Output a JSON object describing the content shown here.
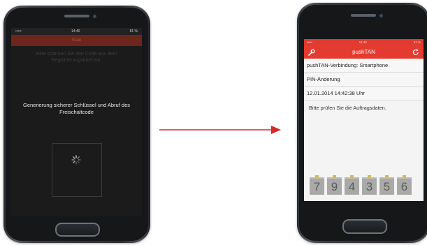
{
  "left_screen": {
    "status_time": "14:40",
    "status_carrier": "•••••",
    "status_battery": "81 %",
    "header_title": "Scan",
    "instruction": "Bitte scannen Sie den Code aus dem Registrierungsbrief ein.",
    "overlay": "Generierung sicherer Schlüssel und Abruf des Freischaltcode"
  },
  "right_screen": {
    "status_carrier": "•••••",
    "status_time": "14:43",
    "status_battery": "81 %",
    "title": "pushTAN",
    "rows": [
      "pushTAN-Verbindung: Smartphone",
      "PIN-Änderung",
      "12.01.2014 14:42:38 Uhr"
    ],
    "message": "Bitte prüfen Sie die Auftragsdaten.",
    "tan_digits": [
      "7",
      "9",
      "4",
      "3",
      "5",
      "6"
    ]
  },
  "colors": {
    "accent_red": "#e53a2f",
    "arrow_red": "#d42a2a"
  },
  "icons": [
    "wrench-icon",
    "refresh-icon",
    "loading-spinner-icon",
    "arrow-right-icon"
  ]
}
